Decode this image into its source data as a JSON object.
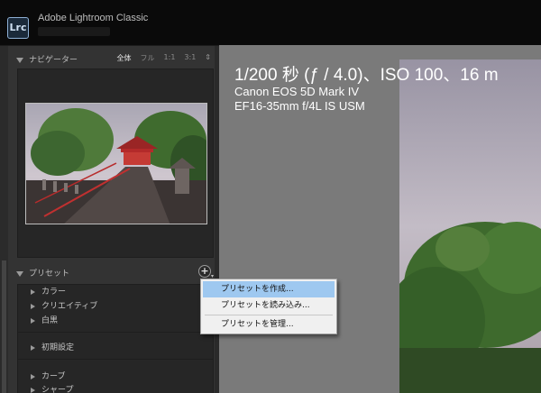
{
  "window": {
    "logo": "Lrc",
    "title": "Adobe Lightroom Classic"
  },
  "navigator": {
    "title": "ナビゲーター",
    "zoom_options": [
      "全体",
      "フル",
      "1:1",
      "3:1"
    ],
    "zoom_active": "全体",
    "zoom_arrows": "⇕"
  },
  "presets": {
    "title": "プリセット",
    "add_symbol": "+",
    "add_caret": "▾",
    "items": [
      "カラー",
      "クリエイティブ",
      "白黒",
      "初期設定",
      "カーブ",
      "シャープ"
    ]
  },
  "context_menu": {
    "items": [
      "プリセットを作成...",
      "プリセットを読み込み...",
      "プリセットを管理..."
    ],
    "highlighted": "プリセットを作成..."
  },
  "photo_info": {
    "line1": "1/200 秒 (ƒ / 4.0)、ISO 100、16 m",
    "line2": "Canon EOS 5D Mark IV",
    "line3": "EF16-35mm f/4L IS USM"
  },
  "colors": {
    "panel_bg": "#333333",
    "main_bg": "#7a7a7a",
    "menu_highlight": "#9ec8f0"
  }
}
